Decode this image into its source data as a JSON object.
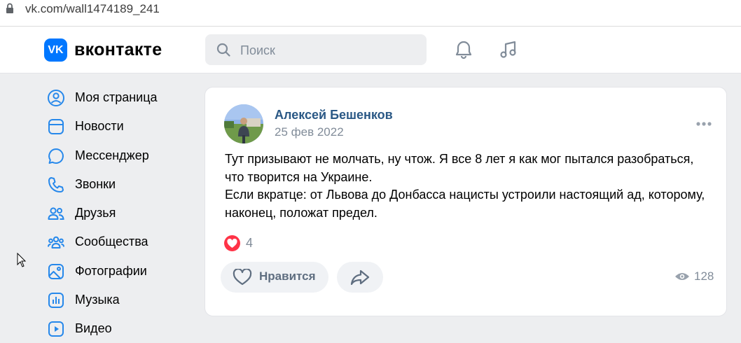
{
  "browser": {
    "url": "vk.com/wall1474189_241"
  },
  "header": {
    "logo_mark": "VK",
    "logo_text": "вконтакте",
    "search_placeholder": "Поиск",
    "icons": [
      "search-icon",
      "bell-icon",
      "music-icon"
    ]
  },
  "sidebar": {
    "items": [
      {
        "label": "Моя страница",
        "icon": "profile-icon"
      },
      {
        "label": "Новости",
        "icon": "news-icon"
      },
      {
        "label": "Мессенджер",
        "icon": "messenger-icon"
      },
      {
        "label": "Звонки",
        "icon": "phone-icon"
      },
      {
        "label": "Друзья",
        "icon": "friends-icon"
      },
      {
        "label": "Сообщества",
        "icon": "communities-icon"
      },
      {
        "label": "Фотографии",
        "icon": "photos-icon"
      },
      {
        "label": "Музыка",
        "icon": "music-chart-icon"
      },
      {
        "label": "Видео",
        "icon": "video-icon"
      }
    ]
  },
  "post": {
    "author": "Алексей Бешенков",
    "date": "25 фев 2022",
    "text": [
      "Тут призывают не молчать, ну чтож. Я все 8 лет я как мог пытался разобраться,",
      "что творится на Украине.",
      "Если вкратце: от Львова до Донбасса нацисты устроили настоящий ад, которому,",
      "наконец, положат предел."
    ],
    "likes_count": "4",
    "like_label": "Нравится",
    "views_count": "128"
  },
  "colors": {
    "accent": "#0077ff",
    "author": "#2a5885",
    "muted": "#818c99",
    "heart": "#ff3347",
    "page_bg": "#edeef0"
  }
}
